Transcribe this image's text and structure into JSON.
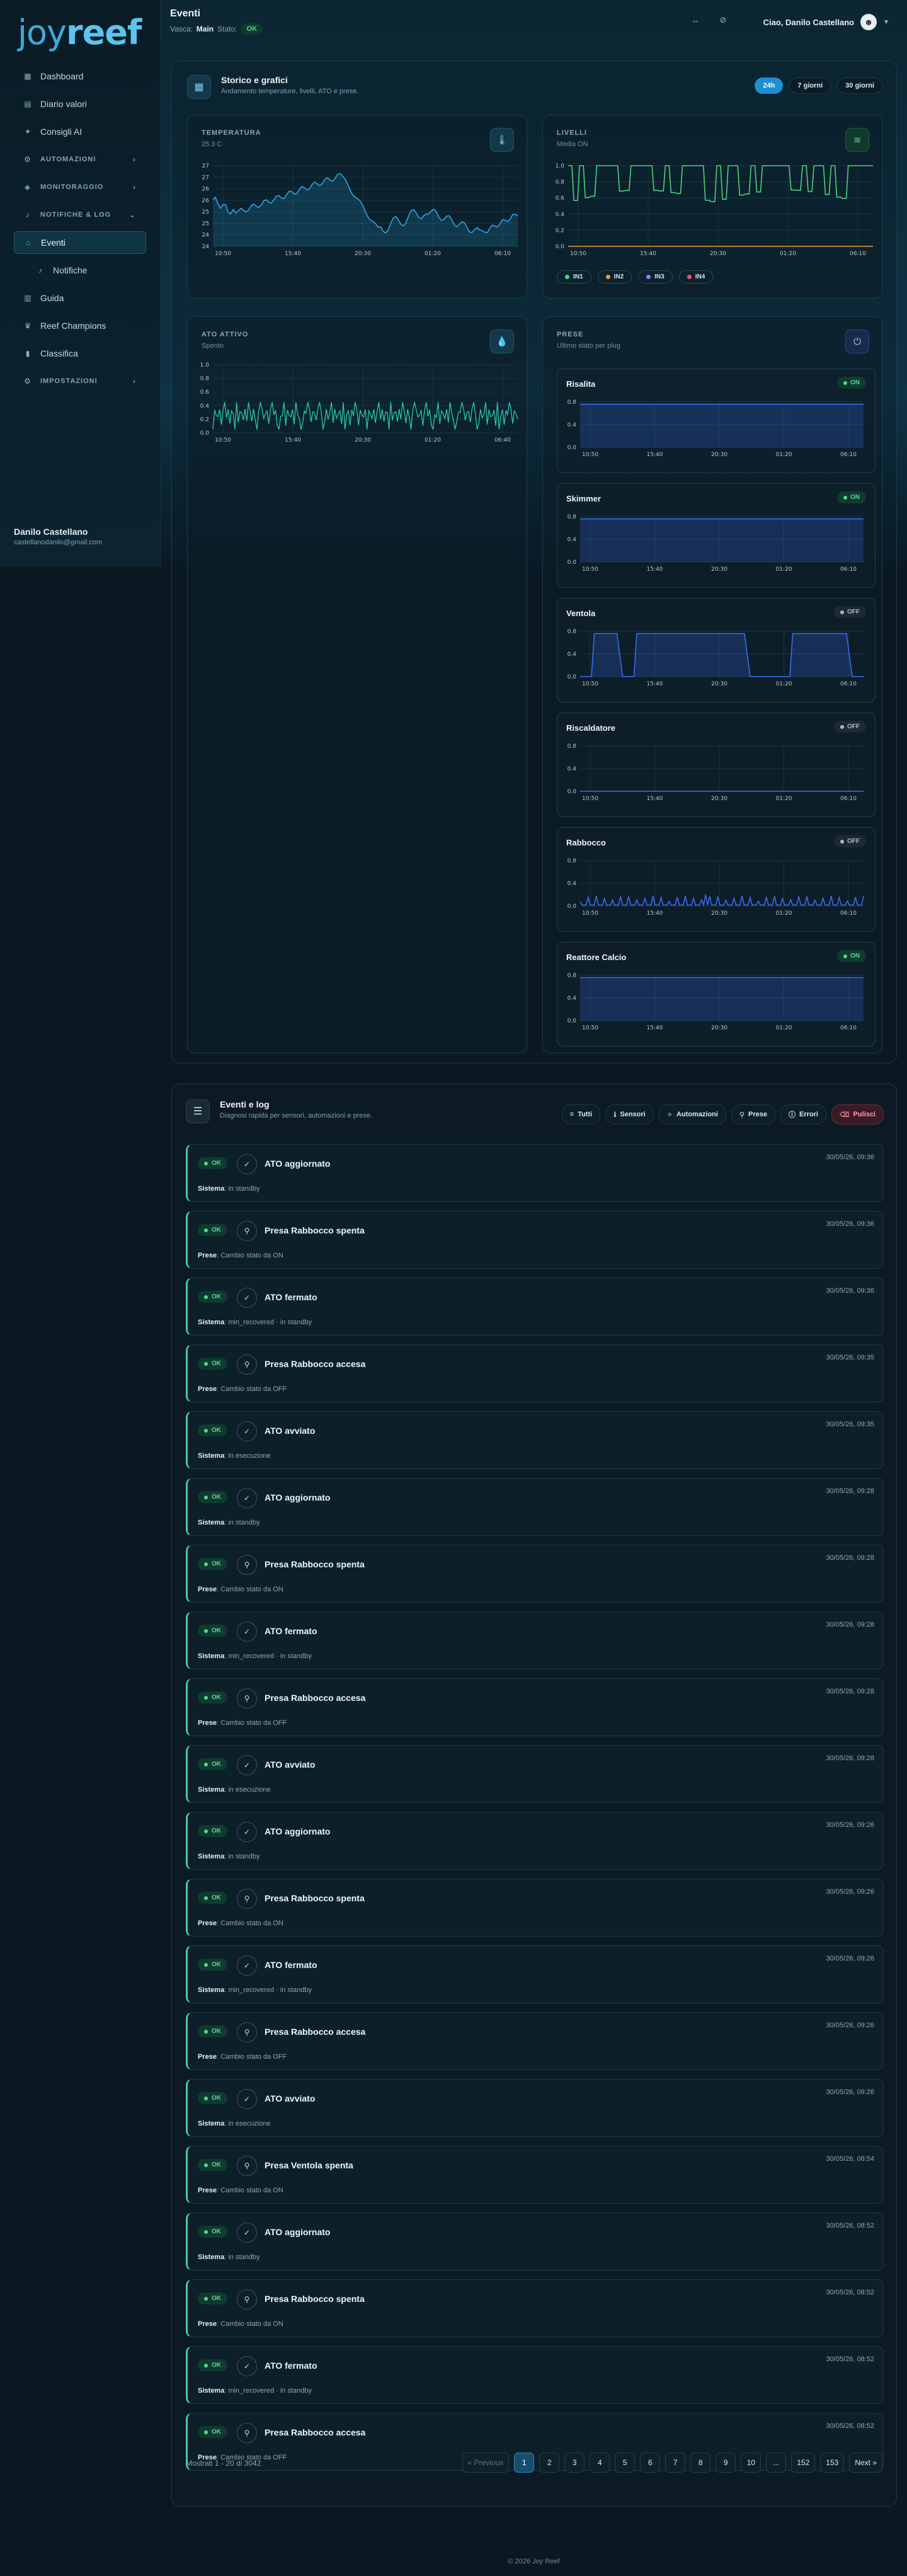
{
  "logo": {
    "part1": "joy",
    "part2": "reef"
  },
  "sidebar": {
    "items": [
      {
        "label": "Dashboard",
        "icon": "dashboard-icon",
        "type": "item"
      },
      {
        "label": "Diario valori",
        "icon": "journal-icon",
        "type": "item"
      },
      {
        "label": "Consigli AI",
        "icon": "sparkle-icon",
        "type": "item"
      },
      {
        "label": "AUTOMAZIONI",
        "icon": "automation-icon",
        "type": "section",
        "chevron": "›"
      },
      {
        "label": "MONITORAGGIO",
        "icon": "monitor-icon",
        "type": "section",
        "chevron": "›"
      },
      {
        "label": "NOTIFICHE & LOG",
        "icon": "bell-icon",
        "type": "section",
        "chevron": "⌄"
      },
      {
        "label": "Eventi",
        "icon": "home-icon",
        "type": "active"
      },
      {
        "label": "Notifiche",
        "icon": "bell-icon",
        "type": "sub"
      },
      {
        "label": "Guida",
        "icon": "book-icon",
        "type": "item"
      },
      {
        "label": "Reef Champions",
        "icon": "trophy-icon",
        "type": "item"
      },
      {
        "label": "Classifica",
        "icon": "ranking-icon",
        "type": "item"
      },
      {
        "label": "IMPOSTAZIONI",
        "icon": "gear-icon",
        "type": "section",
        "chevron": "›"
      }
    ],
    "user_name": "Danilo Castellano",
    "user_email": "castellanodanilo@gmail.com"
  },
  "topbar": {
    "title": "Eventi",
    "view_label": "Vasca:",
    "view_value": "Main",
    "status_label": "Stato:",
    "status_value": "OK",
    "greeting": "Ciao, Danilo Castellano"
  },
  "history": {
    "title": "Storico e grafici",
    "subtitle": "Andamento temperature, livelli, ATO e prese.",
    "ranges": [
      "24h",
      "7 giorni",
      "30 giorni"
    ],
    "active_range": "24h"
  },
  "time_ticks": [
    "10:50",
    "15:40",
    "20:30",
    "01:20",
    "06:10"
  ],
  "temperature": {
    "label": "TEMPERATURA",
    "value": "25.3 C",
    "yticks": [
      "27",
      "27",
      "26",
      "26",
      "25",
      "25",
      "24",
      "24"
    ]
  },
  "levels": {
    "label": "LIVELLI",
    "sub": "Media ON",
    "yticks": [
      "1.0",
      "0.8",
      "0.6",
      "0.4",
      "0.2",
      "0.0"
    ],
    "legend": [
      {
        "name": "IN1",
        "color": "#4cd27a"
      },
      {
        "name": "IN2",
        "color": "#f39a3b"
      },
      {
        "name": "IN3",
        "color": "#9b7bff"
      },
      {
        "name": "IN4",
        "color": "#ff4d6a"
      }
    ]
  },
  "ato": {
    "label": "ATO ATTIVO",
    "sub": "Spento",
    "yticks": [
      "1.0",
      "0.8",
      "0.6",
      "0.4",
      "0.2",
      "0.0"
    ],
    "xticks": [
      "10:50",
      "15:40",
      "20:30",
      "01:20",
      "06:40"
    ]
  },
  "plugs": {
    "label": "PRESE",
    "sub": "Ultimo stato per plug",
    "yticks": [
      "0.8",
      "0.4",
      "0.0"
    ],
    "items": [
      {
        "name": "Risalita",
        "state": "ON",
        "on": true
      },
      {
        "name": "Skimmer",
        "state": "ON",
        "on": true
      },
      {
        "name": "Ventola",
        "state": "OFF",
        "on": false
      },
      {
        "name": "Riscaldatore",
        "state": "OFF",
        "on": false
      },
      {
        "name": "Rabbocco",
        "state": "OFF",
        "on": false
      },
      {
        "name": "Reattore Calcio",
        "state": "ON",
        "on": true
      }
    ]
  },
  "events": {
    "title": "Eventi e log",
    "subtitle": "Diagnosi rapida per sensori, automazioni e prese.",
    "filters": [
      {
        "label": "Tutti",
        "icon": "list-icon"
      },
      {
        "label": "Sensori",
        "icon": "thermometer-icon"
      },
      {
        "label": "Automazioni",
        "icon": "wand-icon"
      },
      {
        "label": "Prese",
        "icon": "plug-icon"
      },
      {
        "label": "Errori",
        "icon": "alert-icon"
      },
      {
        "label": "Pulisci",
        "icon": "eraser-icon"
      }
    ],
    "ok_label": "OK",
    "rows": [
      {
        "title": "ATO aggiornato",
        "time": "30/05/26, 09:36",
        "source": "Sistema",
        "detail": "in standby",
        "kind": "shield"
      },
      {
        "title": "Presa Rabbocco spenta",
        "time": "30/05/26, 09:36",
        "source": "Prese",
        "detail": "Cambio stato da ON",
        "kind": "plug"
      },
      {
        "title": "ATO fermato",
        "time": "30/05/26, 09:36",
        "source": "Sistema",
        "detail": "min_recovered · in standby",
        "kind": "shield"
      },
      {
        "title": "Presa Rabbocco accesa",
        "time": "30/05/26, 09:35",
        "source": "Prese",
        "detail": "Cambio stato da OFF",
        "kind": "plug"
      },
      {
        "title": "ATO avviato",
        "time": "30/05/26, 09:35",
        "source": "Sistema",
        "detail": "in esecuzione",
        "kind": "shield"
      },
      {
        "title": "ATO aggiornato",
        "time": "30/05/26, 09:28",
        "source": "Sistema",
        "detail": "in standby",
        "kind": "shield"
      },
      {
        "title": "Presa Rabbocco spenta",
        "time": "30/05/26, 09:28",
        "source": "Prese",
        "detail": "Cambio stato da ON",
        "kind": "plug"
      },
      {
        "title": "ATO fermato",
        "time": "30/05/26, 09:28",
        "source": "Sistema",
        "detail": "min_recovered · in standby",
        "kind": "shield"
      },
      {
        "title": "Presa Rabbocco accesa",
        "time": "30/05/26, 09:28",
        "source": "Prese",
        "detail": "Cambio stato da OFF",
        "kind": "plug"
      },
      {
        "title": "ATO avviato",
        "time": "30/05/26, 09:28",
        "source": "Sistema",
        "detail": "in esecuzione",
        "kind": "shield"
      },
      {
        "title": "ATO aggiornato",
        "time": "30/05/26, 09:26",
        "source": "Sistema",
        "detail": "in standby",
        "kind": "shield"
      },
      {
        "title": "Presa Rabbocco spenta",
        "time": "30/05/26, 09:26",
        "source": "Prese",
        "detail": "Cambio stato da ON",
        "kind": "plug"
      },
      {
        "title": "ATO fermato",
        "time": "30/05/26, 09:26",
        "source": "Sistema",
        "detail": "min_recovered · in standby",
        "kind": "shield"
      },
      {
        "title": "Presa Rabbocco accesa",
        "time": "30/05/26, 09:26",
        "source": "Prese",
        "detail": "Cambio stato da OFF",
        "kind": "plug"
      },
      {
        "title": "ATO avviato",
        "time": "30/05/26, 09:26",
        "source": "Sistema",
        "detail": "in esecuzione",
        "kind": "shield"
      },
      {
        "title": "Presa Ventola spenta",
        "time": "30/05/26, 08:54",
        "source": "Prese",
        "detail": "Cambio stato da ON",
        "kind": "plug"
      },
      {
        "title": "ATO aggiornato",
        "time": "30/05/26, 08:52",
        "source": "Sistema",
        "detail": "in standby",
        "kind": "shield"
      },
      {
        "title": "Presa Rabbocco spenta",
        "time": "30/05/26, 08:52",
        "source": "Prese",
        "detail": "Cambio stato da ON",
        "kind": "plug"
      },
      {
        "title": "ATO fermato",
        "time": "30/05/26, 08:52",
        "source": "Sistema",
        "detail": "min_recovered · in standby",
        "kind": "shield"
      },
      {
        "title": "Presa Rabbocco accesa",
        "time": "30/05/26, 08:52",
        "source": "Prese",
        "detail": "Cambio stato da OFF",
        "kind": "plug"
      }
    ],
    "showing": "Mostrati 1 - 20 di 3042",
    "pages": [
      "« Previous",
      "1",
      "2",
      "3",
      "4",
      "5",
      "6",
      "7",
      "8",
      "9",
      "10",
      "...",
      "152",
      "153",
      "Next »"
    ],
    "active_page": "1"
  },
  "footer": "© 2026 Joy Reef",
  "colors": {
    "accent": "#1f8ed0",
    "ok": "#5bd49b",
    "temp_line": "#2ba6e6",
    "level_line": "#4cd27a",
    "ato_line": "#2ac6b0",
    "plug_line": "#3a6fff"
  }
}
